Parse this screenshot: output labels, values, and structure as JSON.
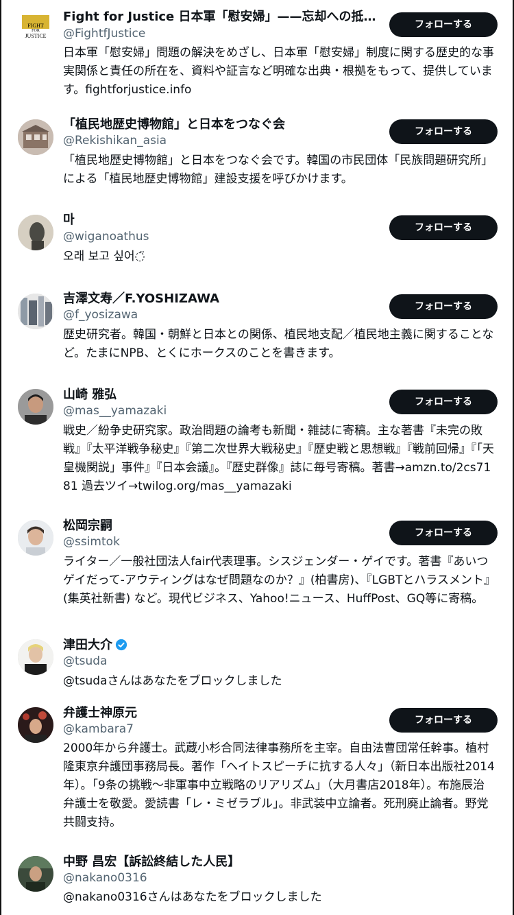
{
  "follow_label": "フォローする",
  "users": [
    {
      "name": "Fight for Justice 日本軍「慰安婦」——忘却への抵抗・…",
      "handle": "@FightfJustice",
      "bio": "日本軍「慰安婦」問題の解決をめざし、日本軍「慰安婦」制度に関する歴史的な事実関係と責任の所在を、資料や証言など明確な出典・根拠をもって、提供しています。fightforjustice.info",
      "logo_lines": [
        "FIGHT",
        "FOR",
        "JUSTICE"
      ],
      "follow": true
    },
    {
      "name": "「植民地歴史博物館」と日本をつなぐ会",
      "handle": "@Rekishikan_asia",
      "bio": "「植民地歴史博物館」と日本をつなぐ会です。韓国の市民団体「民族問題研究所」による「植民地歴史博物館」建設支援を呼びかけます。",
      "follow": true
    },
    {
      "name": "마",
      "handle": "@wiganoathus",
      "bio": "오래 보고 싶어◌̈",
      "follow": true
    },
    {
      "name": "吉澤文寿／F.YOSHIZAWA",
      "handle": "@f_yosizawa",
      "bio": "歴史研究者。韓国・朝鮮と日本との関係、植民地支配／植民地主義に関することなど。たまにNPB、とくにホークスのことを書きます。",
      "follow": true
    },
    {
      "name": "山崎 雅弘",
      "handle": "@mas__yamazaki",
      "bio": "戦史／紛争史研究家。政治問題の論考も新聞・雑誌に寄稿。主な著書『未完の敗戦』『太平洋戦争秘史』『第二次世界大戦秘史』『歴史戦と思想戦』『戦前回帰』『「天皇機関説」事件』『日本会議』。『歴史群像』誌に毎号寄稿。著書→amzn.to/2cs7181 過去ツイ→twilog.org/mas__yamazaki",
      "follow": true
    },
    {
      "name": "松岡宗嗣",
      "handle": "@ssimtok",
      "bio": "ライター／一般社団法人fair代表理事。シスジェンダー・ゲイです。著書『あいつゲイだって-アウティングはなぜ問題なのか？』(柏書房)、『LGBTとハラスメント』(集英社新書) など。現代ビジネス、Yahoo!ニュース、HuffPost、GQ等に寄稿。",
      "follow": true
    },
    {
      "name": "津田大介",
      "handle": "@tsuda",
      "bio": "@tsudaさんはあなたをブロックしました",
      "verified": true,
      "follow": false
    },
    {
      "name": "弁護士神原元",
      "handle": "@kambara7",
      "bio": "2000年から弁護士。武蔵小杉合同法律事務所を主宰。自由法曹団常任幹事。植村隆東京弁護団事務局長。著作「ヘイトスピーチに抗する人々」（新日本出版社2014年）。「9条の挑戦～非軍事中立戦略のリアリズム」（大月書店2018年）。布施辰治弁護士を敬愛。愛読書「レ・ミゼラブル」。非武装中立論者。死刑廃止論者。野党共闘支持。",
      "follow": true
    },
    {
      "name": "中野 昌宏【訴訟終結した人民】",
      "handle": "@nakano0316",
      "bio": "@nakano0316さんはあなたをブロックしました",
      "follow": false
    }
  ],
  "colors": {
    "text": "#0f1419",
    "secondary": "#536471",
    "button_bg": "#0f1419",
    "button_text": "#ffffff",
    "verified": "#1d9bf0",
    "logo_bg": "#d8b433"
  }
}
